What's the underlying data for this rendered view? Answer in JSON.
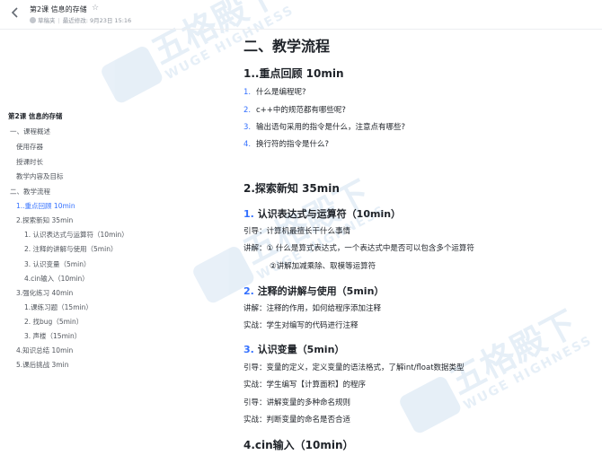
{
  "header": {
    "back_icon": "chevron-left-icon",
    "title": "第2课 信息的存储",
    "star_icon": "star-icon",
    "author": "草稿夹",
    "last_modified": "最近修改: 9月23日 15:16"
  },
  "watermark": {
    "cn": "五格殿下",
    "en": "WUGE HIGHNESS"
  },
  "toc": [
    {
      "label": "第2课 信息的存储"
    },
    {
      "label": "一、课程概述"
    },
    {
      "label": "使用存器"
    },
    {
      "label": "授课时长"
    },
    {
      "label": "教学内容及目标"
    },
    {
      "label": "二、教学流程"
    },
    {
      "label": "1..重点回顾 10min"
    },
    {
      "label": "2.探索新知 35min"
    },
    {
      "label": "1. 认识表达式与运算符（10min）"
    },
    {
      "label": "2. 注释的讲解与使用（5min）"
    },
    {
      "label": "3. 认识变量（5min）"
    },
    {
      "label": "4.cin输入（10min）"
    },
    {
      "label": "3.强化练习 40min"
    },
    {
      "label": "1.课练习题（15min）"
    },
    {
      "label": "2. 找bug（5min）"
    },
    {
      "label": "3. 声楼（15min）"
    },
    {
      "label": "4.知识总结 10min"
    },
    {
      "label": "5.课后挑战 3min"
    }
  ],
  "content": {
    "h1": "二、教学流程",
    "review_title": "1..重点回顾 10min",
    "review_items": [
      {
        "num": "1.",
        "text": "什么是编程呢?"
      },
      {
        "num": "2.",
        "text": "c++中的规范都有哪些呢?"
      },
      {
        "num": "3.",
        "text": "输出语句采用的指令是什么，注意点有哪些?"
      },
      {
        "num": "4.",
        "text": "换行符的指令是什么?"
      }
    ],
    "explore_title": "2.探索新知 35min",
    "sec1": {
      "num": "1.",
      "title": "认识表达式与运算符（10min）",
      "lines": [
        "引导：计算机最擅长干什么事情",
        "讲解：① 什么是算式表达式，一个表达式中是否可以包含多个运算符",
        "②讲解加减乘除、取模等运算符"
      ]
    },
    "sec2": {
      "num": "2.",
      "title": "注释的讲解与使用（5min）",
      "lines": [
        "讲解：注释的作用，如何给程序添加注释",
        "实战：学生对编写的代码进行注释"
      ]
    },
    "sec3": {
      "num": "3.",
      "title": "认识变量（5min）",
      "lines": [
        "引导：变量的定义，定义变量的语法格式，了解int/float数据类型",
        "实战：学生编写【计算面积】的程序",
        "引导：讲解变量的多种命名规则",
        "实战：判断变量的命名是否合适"
      ]
    },
    "cin_title": "4.cin输入（10min）"
  }
}
